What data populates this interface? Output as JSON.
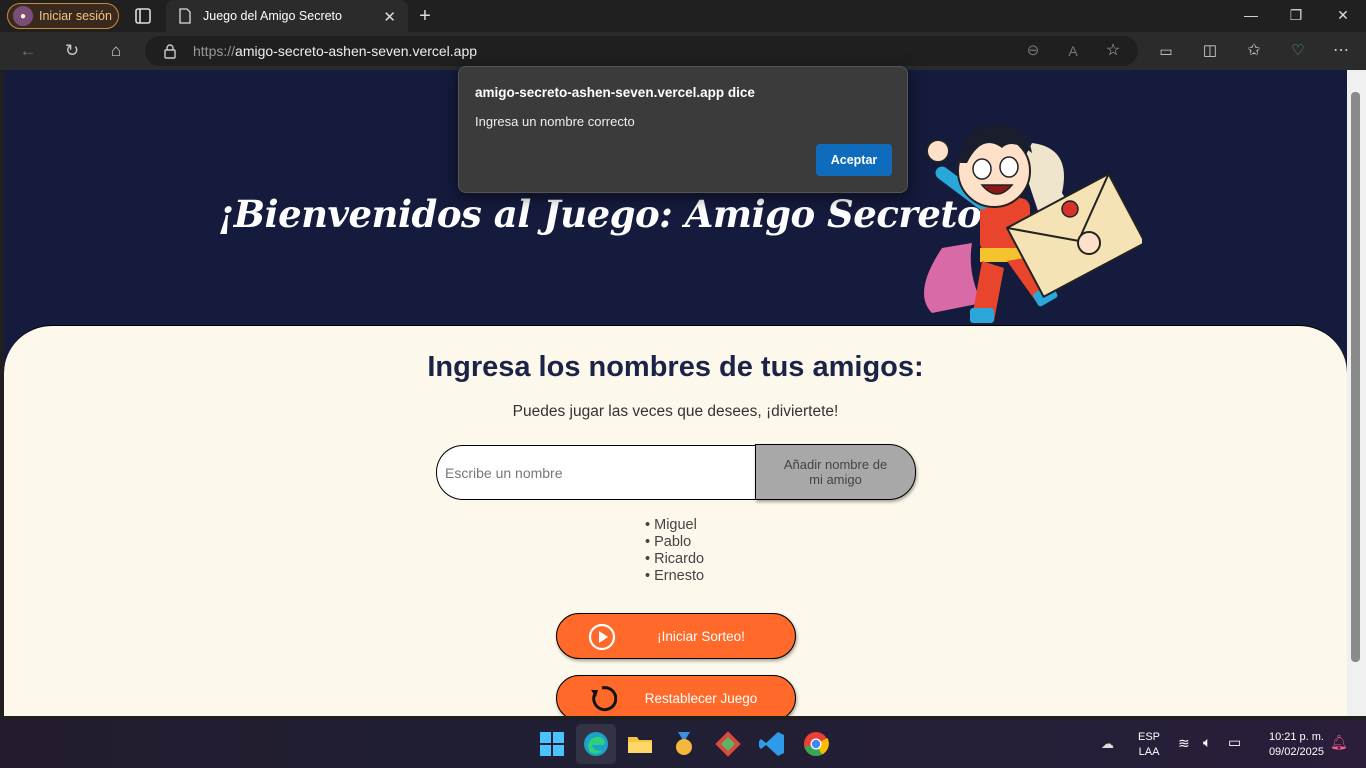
{
  "browser": {
    "signin_label": "Iniciar sesión",
    "tab_title": "Juego del Amigo Secreto",
    "url_scheme": "https://",
    "url_host": "amigo-secreto-ashen-seven.vercel.app"
  },
  "page": {
    "hero_title": "¡Bienvenidos al Juego: Amigo Secreto!",
    "heading": "Ingresa los nombres de tus amigos:",
    "subtitle": "Puedes jugar las veces que desees, ¡diviertete!",
    "input_placeholder": "Escribe un nombre",
    "add_button": "Añadir nombre de mi amigo",
    "friends": [
      "Miguel",
      "Pablo",
      "Ricardo",
      "Ernesto"
    ],
    "draw_button": "¡Iniciar Sorteo!",
    "reset_button": "Restablecer Juego"
  },
  "dialog": {
    "title": "amigo-secreto-ashen-seven.vercel.app dice",
    "message": "Ingresa un nombre correcto",
    "ok_label": "Aceptar"
  },
  "taskbar": {
    "lang_top": "ESP",
    "lang_bottom": "LAA",
    "time": "10:21 p. m.",
    "date": "09/02/2025"
  },
  "colors": {
    "header_bg": "#141b3c",
    "card_bg": "#fdf8ec",
    "accent_orange": "#ff6a2a",
    "dialog_button": "#0f6cbd"
  }
}
